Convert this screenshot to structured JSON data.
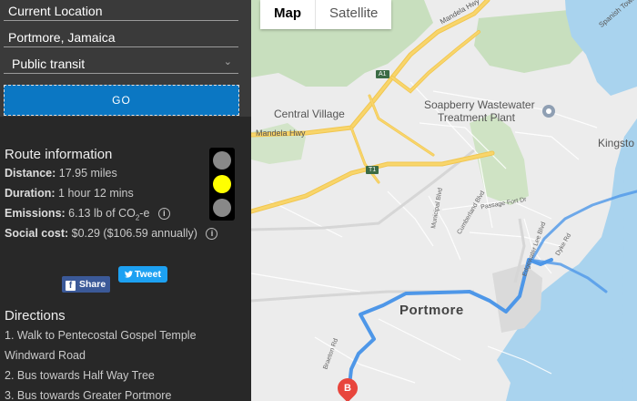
{
  "search": {
    "origin_value": "Current Location",
    "destination_value": "Portmore, Jamaica",
    "mode_selected": "Public transit",
    "go_label": "GO"
  },
  "route_info": {
    "heading": "Route information",
    "distance_label": "Distance:",
    "distance_value": "17.95 miles",
    "duration_label": "Duration:",
    "duration_value": "1 hour 12 mins",
    "emissions_label": "Emissions:",
    "emissions_value": "6.13 lb of CO",
    "emissions_sub": "2",
    "emissions_suffix": "-e",
    "social_label": "Social cost:",
    "social_value": "$0.29 ($106.59 annually)",
    "info_glyph": "i",
    "traffic_light": {
      "active": "yellow",
      "colors": {
        "active": "#ffff00",
        "inactive": "#888888"
      }
    }
  },
  "social": {
    "share_icon": "f",
    "share_label": "Share",
    "tweet_icon": "twitter-bird-icon",
    "tweet_label": "Tweet"
  },
  "directions": {
    "heading": "Directions",
    "steps": [
      "1. Walk to Pentecostal Gospel Temple",
      "Windward Road",
      "2. Bus towards Half Way Tree",
      "3. Bus towards Greater Portmore"
    ]
  },
  "map": {
    "tabs": {
      "map": "Map",
      "satellite": "Satellite"
    },
    "labels": {
      "mandela_hwy_top": "Mandela Hwy",
      "spanish_town": "Spanish Town Rd",
      "a1": "A1",
      "central_village": "Central Village",
      "mandela_hwy": "Mandela Hwy",
      "soapberry_1": "Soapberry Wastewater",
      "soapberry_2": "Treatment Plant",
      "kingston": "Kingsto",
      "t1": "T1",
      "municipal": "Municipal Blvd",
      "cumberland": "Cumberland Blvd",
      "passage_fort": "Passage Fort Dr",
      "dyke": "Dyke Rd",
      "lee_blvd": "Edgewater Lee Blvd",
      "portmore": "Portmore",
      "braeton": "Braeton Rd"
    },
    "marker_b": "B",
    "colors": {
      "route": "#4e97e8",
      "water": "#a9d3ee",
      "park": "#c8dfbe",
      "highway": "#f8d56b",
      "land": "#ececec"
    }
  }
}
